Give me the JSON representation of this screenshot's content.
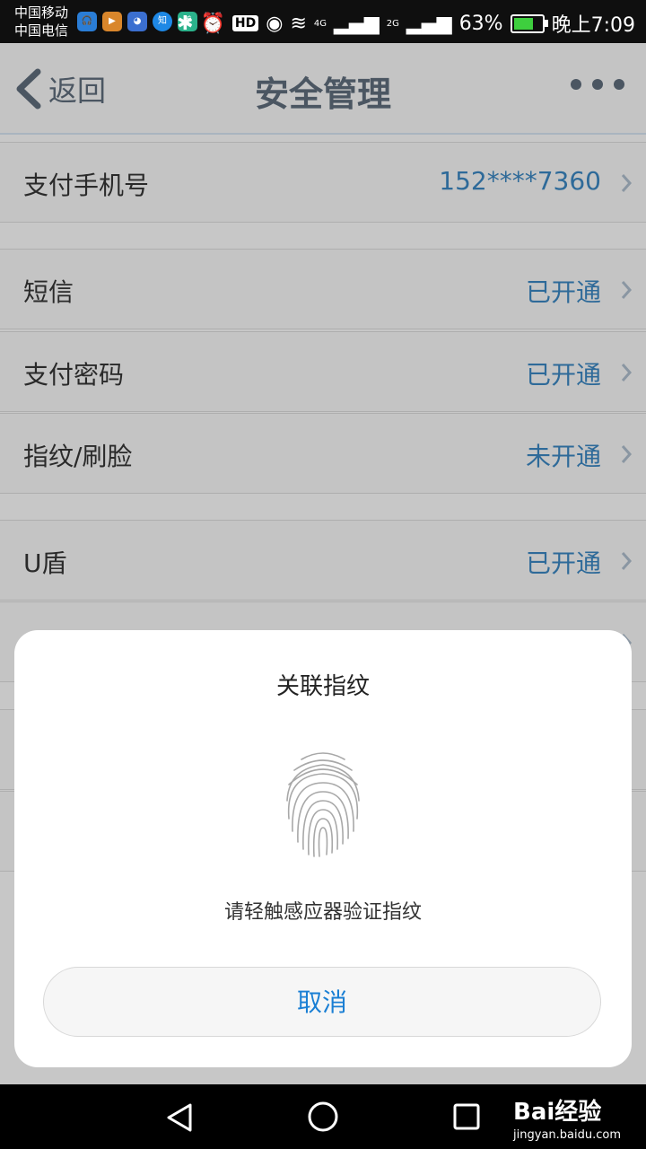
{
  "status": {
    "carrier1": "中国移动",
    "carrier2": "中国电信",
    "dots": "···",
    "battery": "63%",
    "time": "晚上7:09",
    "net1": "4G",
    "net2": "2G"
  },
  "header": {
    "back_label": "返回",
    "title": "安全管理"
  },
  "list": [
    {
      "label": "支付手机号",
      "value": "152****7360"
    },
    {
      "label": "短信",
      "value": "已开通"
    },
    {
      "label": "支付密码",
      "value": "已开通"
    },
    {
      "label": "指纹/刷脸",
      "value": "未开通"
    },
    {
      "label": "U盾",
      "value": "已开通"
    }
  ],
  "dialog": {
    "title": "关联指纹",
    "hint": "请轻触感应器验证指纹",
    "cancel": "取消"
  },
  "watermark": {
    "brand": "Bai经验",
    "url": "jingyan.baidu.com"
  }
}
